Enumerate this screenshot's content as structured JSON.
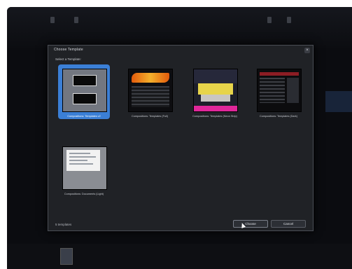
{
  "dialog": {
    "title": "Choose Template",
    "close_icon": "close-icon",
    "section_label": "Select a Template:",
    "templates": [
      {
        "label": "Compositions: Templates v2",
        "selected": true
      },
      {
        "label": "Compositions: Templates (Full)",
        "selected": false
      },
      {
        "label": "Compositions: Templates (Neon Strip)",
        "selected": false
      },
      {
        "label": "Compositions: Templates (Dark)",
        "selected": false
      },
      {
        "label": "Compositions: Documents (Light)",
        "selected": false
      }
    ],
    "status": "5 templates",
    "choose_label": "Choose",
    "cancel_label": "Cancel"
  },
  "colors": {
    "selection": "#3b7fd6",
    "dialog_bg": "#202226"
  }
}
